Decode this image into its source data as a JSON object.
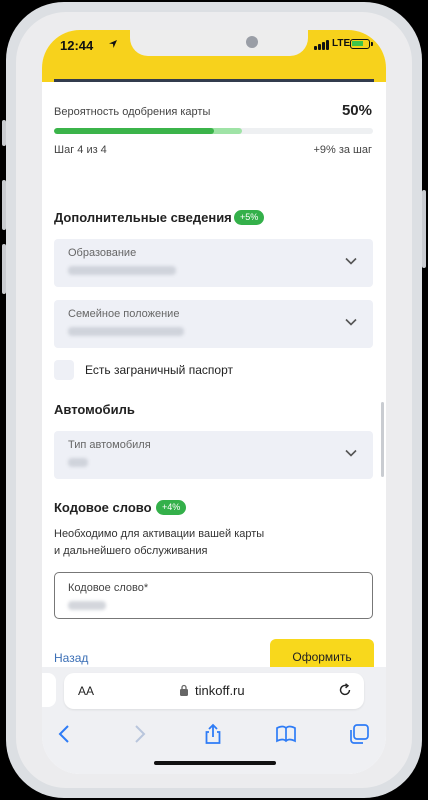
{
  "status_bar": {
    "time": "12:44",
    "network": "LTE"
  },
  "approval": {
    "label": "Вероятность одобрения карты",
    "value_text": "50%",
    "progress": 0.5,
    "progress_next": 0.59
  },
  "steps": {
    "text": "Шаг 4 из 4",
    "bonus": "+9% за шаг"
  },
  "additional": {
    "title": "Дополнительные сведения",
    "badge": "+5%",
    "education_label": "Образование",
    "marital_label": "Семейное положение",
    "passport_label": "Есть заграничный паспорт"
  },
  "car": {
    "title": "Автомобиль",
    "type_label": "Тип автомобиля"
  },
  "codeword": {
    "title": "Кодовое слово",
    "badge": "+4%",
    "info_line1": "Необходимо для активации вашей карты",
    "info_line2": "и дальнейшего обслуживания",
    "input_label": "Кодовое слово*"
  },
  "actions": {
    "back": "Назад",
    "submit": "Оформить"
  },
  "browser": {
    "aa": "AA",
    "url": "tinkoff.ru"
  },
  "colors": {
    "brand_yellow": "#f8d81c",
    "success_green": "#3bb44a",
    "link_blue": "#3b6fb6"
  }
}
